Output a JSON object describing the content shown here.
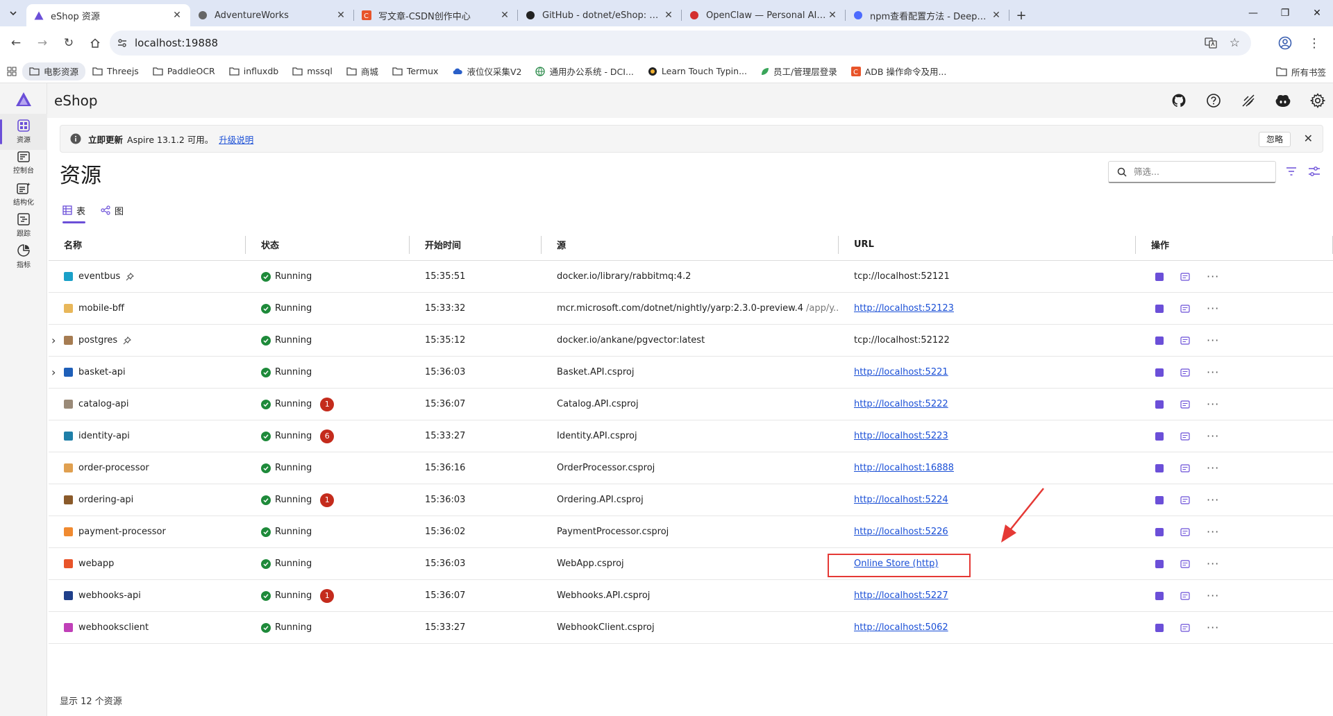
{
  "browser": {
    "tabs": [
      {
        "title": "eShop 资源",
        "icon": "aspire-icon",
        "active": true
      },
      {
        "title": "AdventureWorks",
        "icon": "globe-icon",
        "active": false
      },
      {
        "title": "写文章-CSDN创作中心",
        "icon": "csdn-icon",
        "active": false
      },
      {
        "title": "GitHub - dotnet/eShop: A ref",
        "icon": "github-icon",
        "active": false
      },
      {
        "title": "OpenClaw — Personal AI Ass",
        "icon": "openclaw-icon",
        "active": false
      },
      {
        "title": "npm查看配置方法 - DeepSeek",
        "icon": "deepseek-icon",
        "active": false
      }
    ],
    "address": "localhost:19888",
    "bookmarks": [
      {
        "label": "电影资源",
        "icon": "folder-icon"
      },
      {
        "label": "Threejs",
        "icon": "folder-icon"
      },
      {
        "label": "PaddleOCR",
        "icon": "folder-icon"
      },
      {
        "label": "influxdb",
        "icon": "folder-icon"
      },
      {
        "label": "mssql",
        "icon": "folder-icon"
      },
      {
        "label": "商城",
        "icon": "folder-icon"
      },
      {
        "label": "Termux",
        "icon": "folder-icon"
      },
      {
        "label": "液位仪采集V2",
        "icon": "cloud-icon"
      },
      {
        "label": "通用办公系统 - DCI...",
        "icon": "globe-icon"
      },
      {
        "label": "Learn Touch Typin...",
        "icon": "typing-icon"
      },
      {
        "label": "员工/管理层登录",
        "icon": "leaf-icon"
      },
      {
        "label": "ADB 操作命令及用...",
        "icon": "csdn-icon"
      }
    ],
    "all_bookmarks": "所有书签"
  },
  "app": {
    "title": "eShop",
    "nav": [
      {
        "label": "资源",
        "icon": "resources-icon",
        "active": true
      },
      {
        "label": "控制台",
        "icon": "console-icon",
        "active": false
      },
      {
        "label": "结构化",
        "icon": "structured-logs-icon",
        "active": false
      },
      {
        "label": "跟踪",
        "icon": "traces-icon",
        "active": false
      },
      {
        "label": "指标",
        "icon": "metrics-icon",
        "active": false
      }
    ],
    "banner": {
      "strong": "立即更新",
      "message": "Aspire 13.1.2 可用。",
      "link": "升级说明",
      "dismiss": "忽略"
    },
    "page_title": "资源",
    "filter_placeholder": "筛选...",
    "view_tabs": [
      {
        "label": "表",
        "active": true
      },
      {
        "label": "图",
        "active": false
      }
    ],
    "columns": [
      "名称",
      "状态",
      "开始时间",
      "源",
      "URL",
      "操作"
    ],
    "rows": [
      {
        "name": "eventbus",
        "icon_color": "#1aa0c8",
        "pinned": true,
        "expandable": false,
        "state": "Running",
        "errors": "",
        "start": "15:35:51",
        "source": "docker.io/library/rabbitmq:4.2",
        "source_extra": "",
        "url": "tcp://localhost:52121",
        "url_link": false
      },
      {
        "name": "mobile-bff",
        "icon_color": "#e8b75a",
        "pinned": false,
        "expandable": false,
        "state": "Running",
        "errors": "",
        "start": "15:33:32",
        "source": "mcr.microsoft.com/dotnet/nightly/yarp:2.3.0-preview.4",
        "source_extra": "/app/y...",
        "url": "http://localhost:52123",
        "url_link": true
      },
      {
        "name": "postgres",
        "icon_color": "#a67c52",
        "pinned": true,
        "expandable": true,
        "state": "Running",
        "errors": "",
        "start": "15:35:12",
        "source": "docker.io/ankane/pgvector:latest",
        "source_extra": "",
        "url": "tcp://localhost:52122",
        "url_link": false
      },
      {
        "name": "basket-api",
        "icon_color": "#1f5fb8",
        "pinned": false,
        "expandable": true,
        "state": "Running",
        "errors": "",
        "start": "15:36:03",
        "source": "Basket.API.csproj",
        "source_extra": "",
        "url": "http://localhost:5221",
        "url_link": true
      },
      {
        "name": "catalog-api",
        "icon_color": "#9a8a78",
        "pinned": false,
        "expandable": false,
        "state": "Running",
        "errors": "1",
        "start": "15:36:07",
        "source": "Catalog.API.csproj",
        "source_extra": "",
        "url": "http://localhost:5222",
        "url_link": true
      },
      {
        "name": "identity-api",
        "icon_color": "#1f7fa8",
        "pinned": false,
        "expandable": false,
        "state": "Running",
        "errors": "6",
        "start": "15:33:27",
        "source": "Identity.API.csproj",
        "source_extra": "",
        "url": "http://localhost:5223",
        "url_link": true
      },
      {
        "name": "order-processor",
        "icon_color": "#e0a050",
        "pinned": false,
        "expandable": false,
        "state": "Running",
        "errors": "",
        "start": "15:36:16",
        "source": "OrderProcessor.csproj",
        "source_extra": "",
        "url": "http://localhost:16888",
        "url_link": true
      },
      {
        "name": "ordering-api",
        "icon_color": "#8a5a2a",
        "pinned": false,
        "expandable": false,
        "state": "Running",
        "errors": "1",
        "start": "15:36:03",
        "source": "Ordering.API.csproj",
        "source_extra": "",
        "url": "http://localhost:5224",
        "url_link": true
      },
      {
        "name": "payment-processor",
        "icon_color": "#f08a30",
        "pinned": false,
        "expandable": false,
        "state": "Running",
        "errors": "",
        "start": "15:36:02",
        "source": "PaymentProcessor.csproj",
        "source_extra": "",
        "url": "http://localhost:5226",
        "url_link": true
      },
      {
        "name": "webapp",
        "icon_color": "#e8542a",
        "pinned": false,
        "expandable": false,
        "state": "Running",
        "errors": "",
        "start": "15:36:03",
        "source": "WebApp.csproj",
        "source_extra": "",
        "url": "Online Store (http)",
        "url_link": true
      },
      {
        "name": "webhooks-api",
        "icon_color": "#1f3f8a",
        "pinned": false,
        "expandable": false,
        "state": "Running",
        "errors": "1",
        "start": "15:36:07",
        "source": "Webhooks.API.csproj",
        "source_extra": "",
        "url": "http://localhost:5227",
        "url_link": true
      },
      {
        "name": "webhooksclient",
        "icon_color": "#c040b8",
        "pinned": false,
        "expandable": false,
        "state": "Running",
        "errors": "",
        "start": "15:33:27",
        "source": "WebhookClient.csproj",
        "source_extra": "",
        "url": "http://localhost:5062",
        "url_link": true
      }
    ],
    "footer": "显示 12 个资源",
    "accent": "#6b4fd8",
    "annotation_color": "#e53935"
  }
}
